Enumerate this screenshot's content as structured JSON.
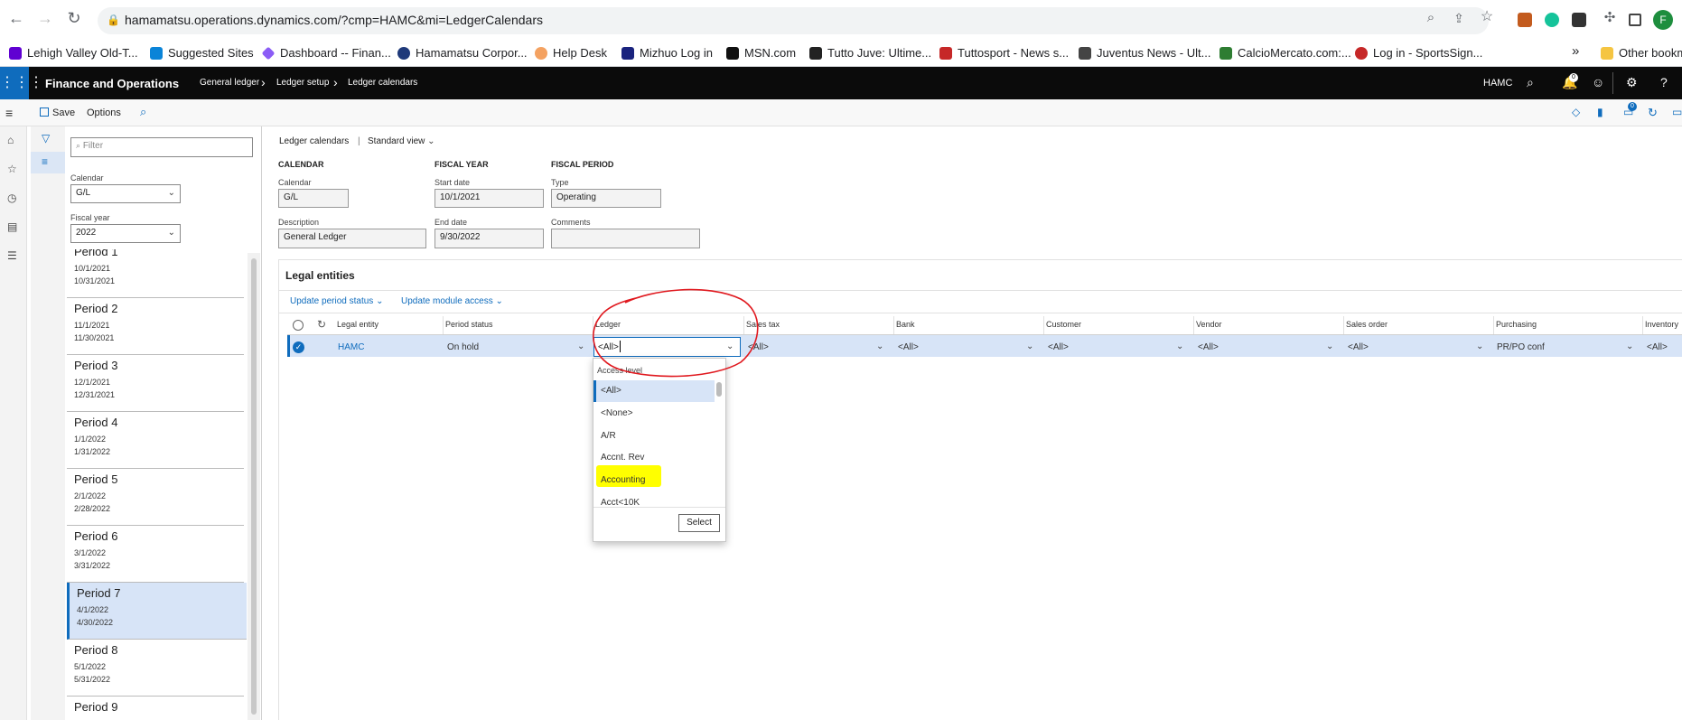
{
  "browser": {
    "url": "hamamatsu.operations.dynamics.com/?cmp=HAMC&mi=LedgerCalendars",
    "profile_initial": "F",
    "bookmarks": [
      "Lehigh Valley Old-T...",
      "Suggested Sites",
      "Dashboard -- Finan...",
      "Hamamatsu Corpor...",
      "Help Desk",
      "Mizhuo Log in",
      "MSN.com",
      "Tutto Juve: Ultime...",
      "Tuttosport - News s...",
      "Juventus News - Ult...",
      "CalcioMercato.com:...",
      "Log in - SportsSign..."
    ],
    "overflow": "»",
    "other_bookmarks": "Other bookm"
  },
  "appbar": {
    "title": "Finance and Operations",
    "breadcrumbs": [
      "General ledger",
      "Ledger setup",
      "Ledger calendars"
    ],
    "company": "HAMC",
    "notification_count": "0"
  },
  "actionbar": {
    "save": "Save",
    "options": "Options",
    "badge": "0"
  },
  "filterpane": {
    "filter_placeholder": "Filter",
    "calendar_label": "Calendar",
    "calendar_value": "G/L",
    "fiscal_year_label": "Fiscal year",
    "fiscal_year_value": "2022",
    "periods": [
      {
        "name": "Period 1",
        "start": "10/1/2021",
        "end": "10/31/2021"
      },
      {
        "name": "Period 2",
        "start": "11/1/2021",
        "end": "11/30/2021"
      },
      {
        "name": "Period 3",
        "start": "12/1/2021",
        "end": "12/31/2021"
      },
      {
        "name": "Period 4",
        "start": "1/1/2022",
        "end": "1/31/2022"
      },
      {
        "name": "Period 5",
        "start": "2/1/2022",
        "end": "2/28/2022"
      },
      {
        "name": "Period 6",
        "start": "3/1/2022",
        "end": "3/31/2022"
      },
      {
        "name": "Period 7",
        "start": "4/1/2022",
        "end": "4/30/2022"
      },
      {
        "name": "Period 8",
        "start": "5/1/2022",
        "end": "5/31/2022"
      },
      {
        "name": "Period 9",
        "start": "",
        "end": ""
      }
    ]
  },
  "main": {
    "page_name": "Ledger calendars",
    "sep": "|",
    "view": "Standard view",
    "calendar": {
      "header": "CALENDAR",
      "calendar_label": "Calendar",
      "calendar_value": "G/L",
      "description_label": "Description",
      "description_value": "General Ledger"
    },
    "fiscal_year": {
      "header": "FISCAL YEAR",
      "start_label": "Start date",
      "start_value": "10/1/2021",
      "end_label": "End date",
      "end_value": "9/30/2022"
    },
    "fiscal_period": {
      "header": "FISCAL PERIOD",
      "type_label": "Type",
      "type_value": "Operating",
      "comments_label": "Comments",
      "comments_value": ""
    },
    "legal_entities": {
      "title": "Legal entities",
      "update_period_status": "Update period status",
      "update_module_access": "Update module access",
      "columns": [
        "Legal entity",
        "Period status",
        "Ledger",
        "Sales tax",
        "Bank",
        "Customer",
        "Vendor",
        "Sales order",
        "Purchasing",
        "Inventory"
      ],
      "row": {
        "legal_entity": "HAMC",
        "period_status": "On hold",
        "ledger": "<All>",
        "sales_tax": "<All>",
        "bank": "<All>",
        "customer": "<All>",
        "vendor": "<All>",
        "sales_order": "<All>",
        "purchasing": "PR/PO conf",
        "inventory": "<All>"
      }
    },
    "dropdown": {
      "header": "Access level",
      "options": [
        "<All>",
        "<None>",
        "A/R",
        "Accnt. Rev",
        "Accounting",
        "Acct<10K"
      ],
      "selected": "<All>",
      "highlighted": "Accounting",
      "select_button": "Select"
    }
  },
  "colors": {
    "accent": "#0f6cbd",
    "appbar": "#0b0b0b",
    "row_selected": "#d7e4f7",
    "highlight": "#ffff00",
    "annotation": "#e0191f"
  }
}
